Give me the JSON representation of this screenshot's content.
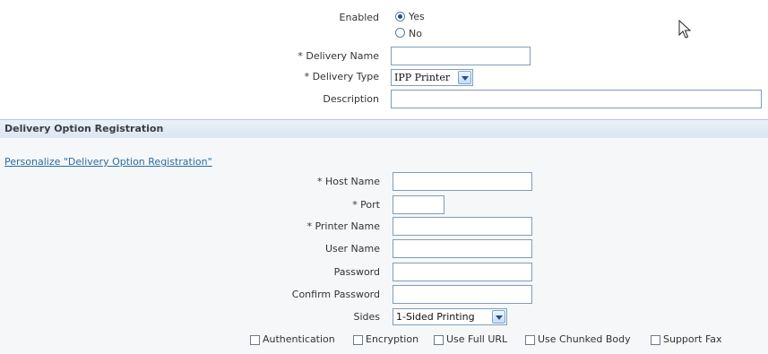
{
  "general": {
    "enabled_label": "Enabled",
    "enabled_options": [
      "Yes",
      "No"
    ],
    "enabled_selected": "Yes",
    "delivery_name_label": "* Delivery Name",
    "delivery_name_value": "",
    "delivery_type_label": "* Delivery Type",
    "delivery_type_value": "IPP Printer",
    "description_label": "Description",
    "description_value": ""
  },
  "section": {
    "title": "Delivery Option Registration",
    "personalize_link": "Personalize \"Delivery Option Registration\""
  },
  "fields": {
    "host_name_label": "* Host Name",
    "port_label": "* Port",
    "printer_name_label": "* Printer Name",
    "user_name_label": "User Name",
    "password_label": "Password",
    "confirm_password_label": "Confirm Password",
    "sides_label": "Sides",
    "sides_value": "1-Sided Printing"
  },
  "checkboxes": [
    {
      "label": "Authentication",
      "checked": false
    },
    {
      "label": "Encryption",
      "checked": false
    },
    {
      "label": "Use Full URL",
      "checked": false
    },
    {
      "label": "Use Chunked Body",
      "checked": false
    },
    {
      "label": "Support Fax",
      "checked": false
    }
  ],
  "colors": {
    "section_header": "#dbe6f2",
    "section_body": "#f6f7f8",
    "link": "#2b6c9c",
    "field_border": "#7f9db9"
  },
  "icons": {
    "cursor": "mouse-pointer-icon"
  }
}
